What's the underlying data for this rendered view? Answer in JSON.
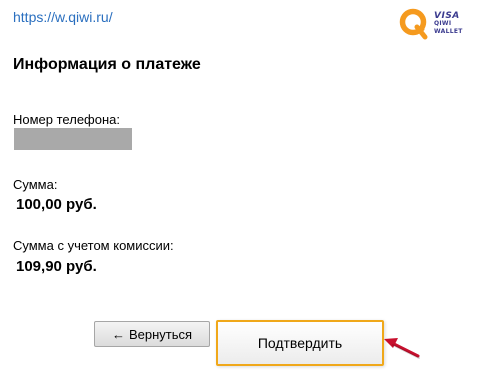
{
  "header": {
    "url": "https://w.qiwi.ru/",
    "logo": {
      "brand": "VISA",
      "line1": "QIWI",
      "line2": "WALLET",
      "color": "#f59a1e"
    }
  },
  "page": {
    "title": "Информация о платеже"
  },
  "fields": {
    "phone_label": "Номер телефона:",
    "amount_label": "Сумма:",
    "amount_value": "100,00 руб.",
    "commission_label": "Сумма с учетом комиссии:",
    "commission_value": "109,90 руб."
  },
  "buttons": {
    "back_arrow": "←",
    "back_label": "Вернуться",
    "confirm_label": "Подтвердить"
  },
  "colors": {
    "link": "#2a6fbf",
    "confirm_border": "#f0a81a",
    "annotation_arrow": "#c8102e"
  }
}
